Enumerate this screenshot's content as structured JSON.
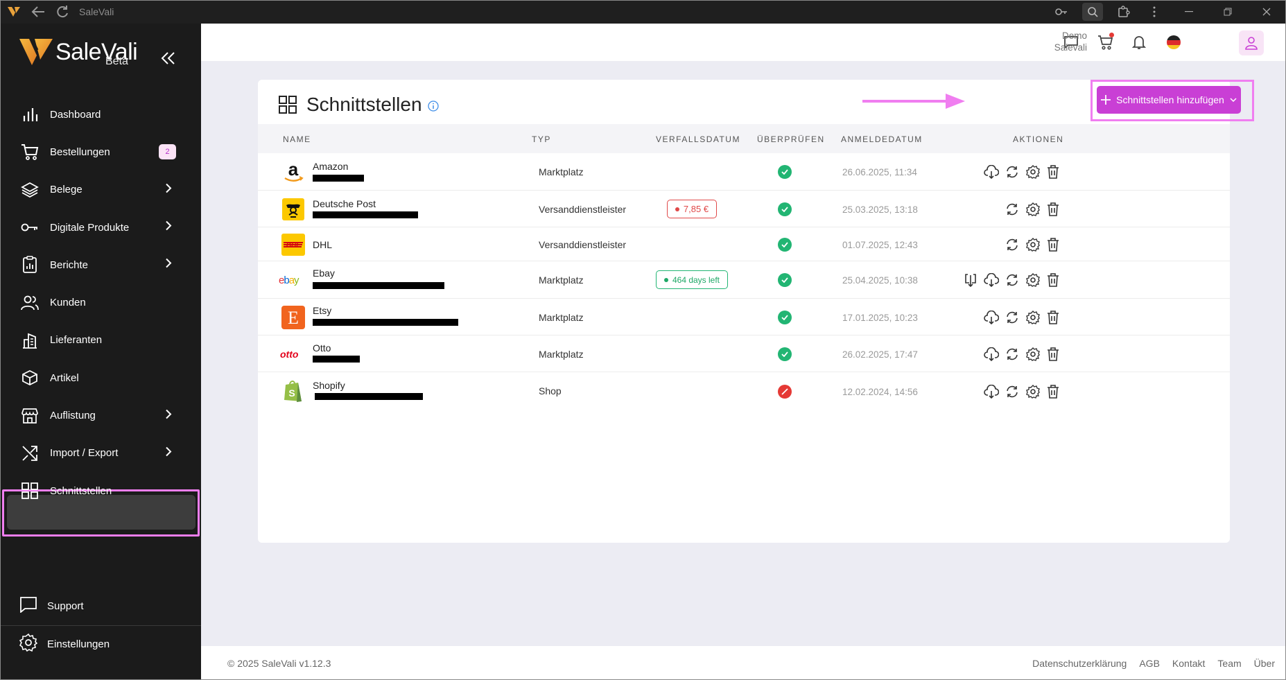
{
  "window": {
    "title": "SaleVali"
  },
  "brand": {
    "name": "SaleVali",
    "beta": "Beta"
  },
  "sidebar": {
    "items": [
      {
        "label": "Dashboard"
      },
      {
        "label": "Bestellungen",
        "badge": "2"
      },
      {
        "label": "Belege"
      },
      {
        "label": "Digitale Produkte"
      },
      {
        "label": "Berichte"
      },
      {
        "label": "Kunden"
      },
      {
        "label": "Lieferanten"
      },
      {
        "label": "Artikel"
      },
      {
        "label": "Auflistung"
      },
      {
        "label": "Import / Export"
      },
      {
        "label": "Schnittstellen"
      }
    ],
    "support": "Support",
    "settings": "Einstellungen"
  },
  "header": {
    "user_first": "Demo",
    "user_last": "Salevali"
  },
  "page": {
    "title": "Schnittstellen",
    "add_button": "Schnittstellen hinzufügen"
  },
  "table": {
    "columns": [
      "NAME",
      "TYP",
      "VERFALLSDATUM",
      "ÜBERPRÜFEN",
      "ANMELDEDATUM",
      "AKTIONEN"
    ],
    "rows": [
      {
        "name": "Amazon",
        "typ": "Marktplatz",
        "verfall": "",
        "status": "ok",
        "date": "26.06.2025, 11:34"
      },
      {
        "name": "Deutsche Post",
        "typ": "Versanddienstleister",
        "verfall": "7,85 €",
        "status": "ok",
        "date": "25.03.2025, 13:18"
      },
      {
        "name": "DHL",
        "typ": "Versanddienstleister",
        "verfall": "",
        "status": "ok",
        "date": "01.07.2025, 12:43"
      },
      {
        "name": "Ebay",
        "typ": "Marktplatz",
        "verfall": "464 days left",
        "status": "ok",
        "date": "25.04.2025, 10:38"
      },
      {
        "name": "Etsy",
        "typ": "Marktplatz",
        "verfall": "",
        "status": "ok",
        "date": "17.01.2025, 10:23"
      },
      {
        "name": "Otto",
        "typ": "Marktplatz",
        "verfall": "",
        "status": "ok",
        "date": "26.02.2025, 17:47"
      },
      {
        "name": "Shopify",
        "typ": "Shop",
        "verfall": "",
        "status": "error",
        "date": "12.02.2024, 14:56"
      }
    ]
  },
  "footer": {
    "copyright": "© 2025 SaleVali v1.12.3",
    "links": [
      "Datenschutzerklärung",
      "AGB",
      "Kontakt",
      "Team",
      "Über"
    ]
  },
  "colors": {
    "accent": "#c93fd5",
    "highlight": "#f07ef0",
    "ok": "#22b573",
    "error": "#e53935"
  }
}
